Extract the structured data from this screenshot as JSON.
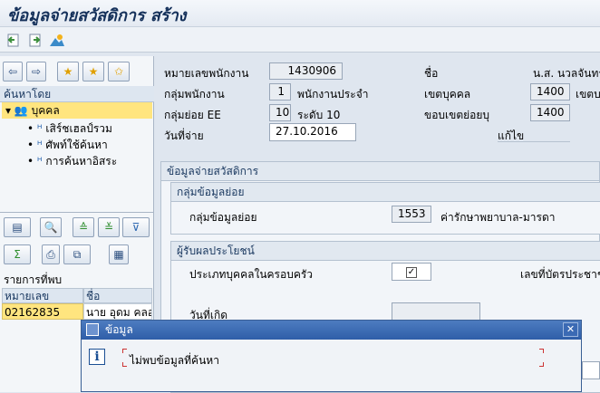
{
  "window": {
    "title": "ข้อมูลจ่ายสวัสดิการ สร้าง"
  },
  "toolbar": {
    "icons": [
      "back-page-icon",
      "forward-page-icon",
      "landscape-icon"
    ]
  },
  "nav": {
    "back": "⇦",
    "forward": "⇨"
  },
  "search": {
    "header": "ค้นหาโดย",
    "root": "บุคคล",
    "items": [
      {
        "label": "เสิร์ชเฮลป์รวม"
      },
      {
        "label": "ศัพท์ใช้ค้นหา"
      },
      {
        "label": "การค้นหาอิสระ"
      }
    ]
  },
  "results": {
    "header": "รายการที่พบ",
    "columns": [
      "หมายเลขพนักงาน",
      "ชื่อ"
    ],
    "rows": [
      {
        "id": "02162835",
        "name": "นาย อุดม คลอด"
      }
    ]
  },
  "form": {
    "emp_no_label": "หมายเลขพนักงาน",
    "emp_no": "1430906",
    "name_label": "ชื่อ",
    "name": "น.ส. นวลจันทร์",
    "group_label": "กลุ่มพนักงาน",
    "group_code": "1",
    "group_text": "พนักงานประจำ",
    "area_label": "เขตบุคคล",
    "area_code": "1400",
    "area_text": "เขตบ",
    "subgroup_label": "กลุ่มย่อย EE",
    "subgroup_code": "10",
    "subgroup_text": "ระดับ 10",
    "subarea_label": "ขอบเขตย่อยบุ",
    "subarea_code": "1400",
    "paydate_label": "วันที่จ่าย",
    "paydate": "27.10.2016",
    "edit_label": "แก้ไข"
  },
  "welfare": {
    "title": "ข้อมูลจ่ายสวัสดิการ",
    "subgroup_box": "กลุ่มข้อมูลย่อย",
    "subtype_label": "กลุ่มข้อมูลย่อย",
    "subtype_code": "1553",
    "subtype_text": "ค่ารักษาพยาบาล-มารดา",
    "beneficiary_box": "ผู้รับผลประโยชน์",
    "family_type_label": "ประเภทบุคคลในครอบครัว",
    "idcard_label": "เลขที่บัตรประชาช",
    "birthdate_label": "วันที่เกิด"
  },
  "dialog": {
    "title": "ข้อมูล",
    "message": "ไม่พบข้อมูลที่ค้นหา",
    "close": "✕"
  }
}
